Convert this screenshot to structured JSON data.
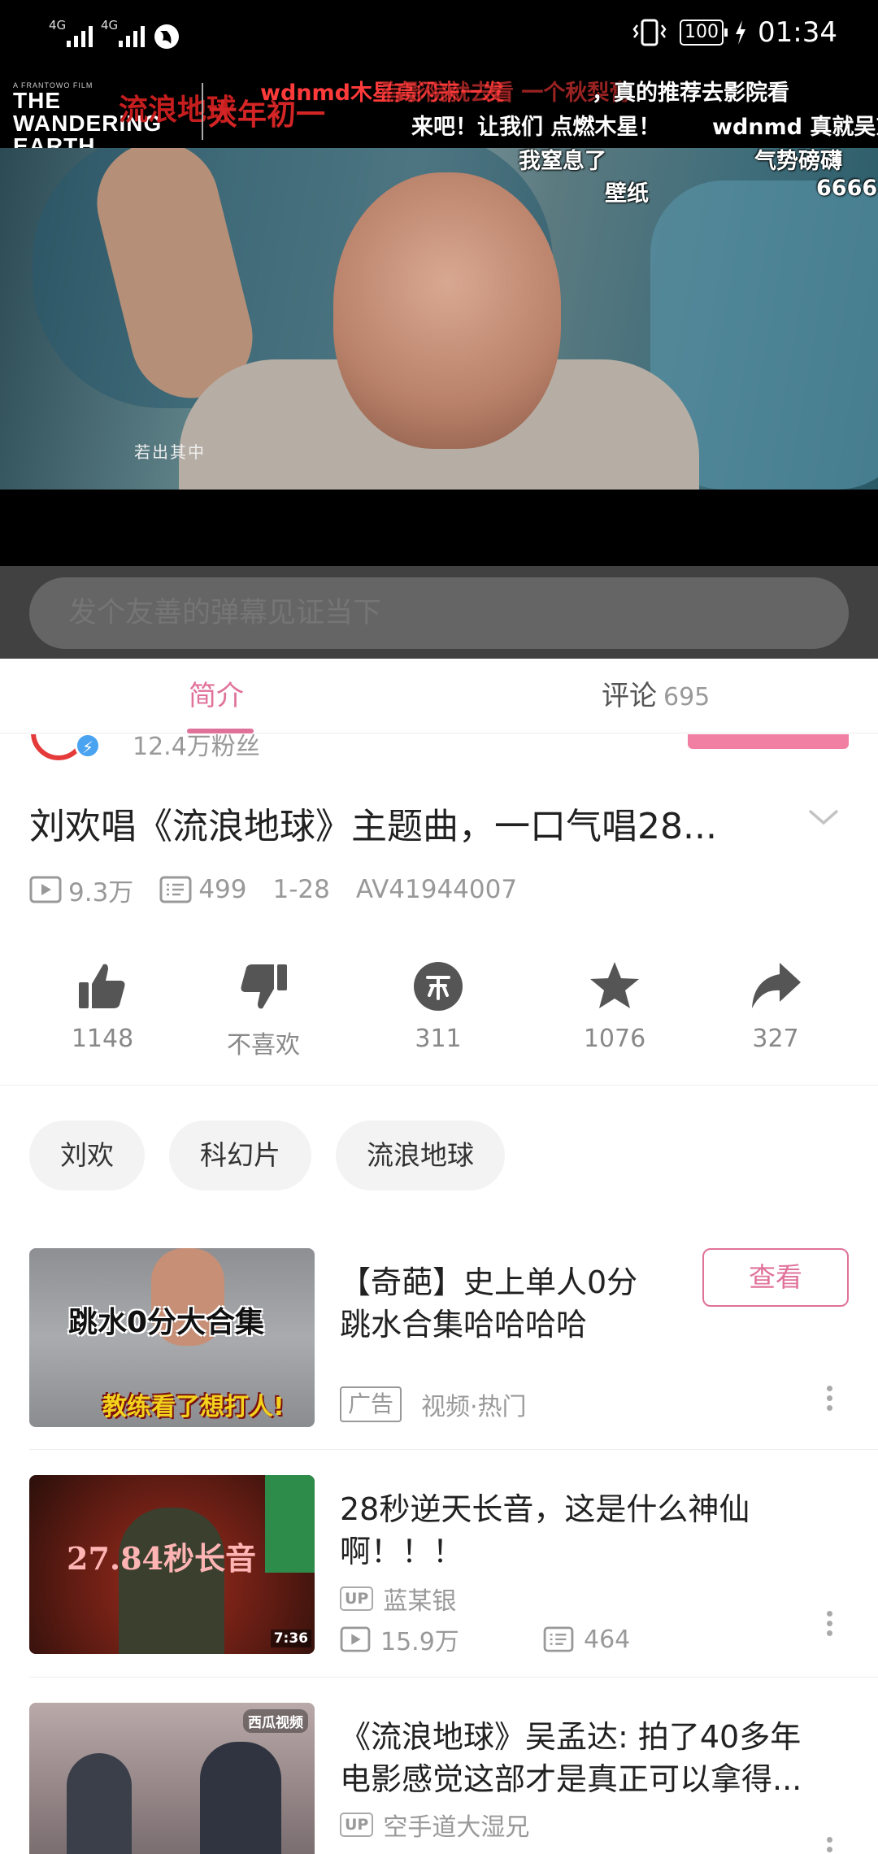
{
  "status_bar": {
    "network1": "4G",
    "network2": "4G",
    "battery": "100",
    "time": "01:34"
  },
  "player": {
    "movie_logo_en": "THE WANDERING EARTH",
    "movie_logo_small": "A FRANTOWO FILM",
    "movie_logo_cn": "流浪地球",
    "movie_logo_slogan": "大年初一",
    "scene_subtitle": "若出其中",
    "danmaku": [
      {
        "text": "wdnmd木星高闪来一发",
        "color": "#ff3a3a"
      },
      {
        "text": "有影院就去看 一个秋梨膏",
        "color": "#ff3a3a"
      },
      {
        "text": "，真的推荐去影院看",
        "color": "#ffffff"
      },
      {
        "text": "来吧！让我们 点燃木星！",
        "color": "#ffffff"
      },
      {
        "text": "wdnmd 真就吴京",
        "color": "#ffffff"
      },
      {
        "text": "我窒息了",
        "color": "#ffffff"
      },
      {
        "text": "气势磅礴",
        "color": "#ffffff"
      },
      {
        "text": "壁纸",
        "color": "#ffffff"
      },
      {
        "text": "6666",
        "color": "#ffffff"
      }
    ]
  },
  "danmaku_input": {
    "placeholder": "发个友善的弹幕见证当下"
  },
  "tabs": [
    {
      "label": "简介",
      "active": true
    },
    {
      "label": "评论",
      "count": "695",
      "active": false
    }
  ],
  "uploader": {
    "fans": "12.4万粉丝"
  },
  "video": {
    "title": "刘欢唱《流浪地球》主题曲，一口气唱28...",
    "plays": "9.3万",
    "danmaku_count": "499",
    "date": "1-28",
    "av": "AV41944007"
  },
  "actions": [
    {
      "name": "like",
      "icon": "thumb-up-icon",
      "label": "1148"
    },
    {
      "name": "dislike",
      "icon": "thumb-down-icon",
      "label": "不喜欢"
    },
    {
      "name": "coin",
      "icon": "coin-icon",
      "label": "311"
    },
    {
      "name": "favorite",
      "icon": "star-icon",
      "label": "1076"
    },
    {
      "name": "share",
      "icon": "share-icon",
      "label": "327"
    }
  ],
  "tags": [
    "刘欢",
    "科幻片",
    "流浪地球"
  ],
  "recommendations": [
    {
      "title_line1": "【奇葩】史上单人0分",
      "title_line2": "跳水合集哈哈哈哈",
      "ad_label": "广告",
      "category": "视频·热门",
      "button": "查看",
      "thumb_text1": "跳水0分大合集",
      "thumb_text2": "教练看了想打人!"
    },
    {
      "title_line1": "28秒逆天长音，这是什么神仙",
      "title_line2": "啊！！！",
      "up_badge": "UP",
      "uploader": "蓝某银",
      "plays": "15.9万",
      "danmaku": "464",
      "thumb_text1": "27.84秒长音",
      "thumb_duration": "7:36"
    },
    {
      "title_line1": "《流浪地球》吴孟达: 拍了40多年",
      "title_line2": "电影感觉这部才是真正可以拿得...",
      "up_badge": "UP",
      "uploader": "空手道大湿兄",
      "thumb_badge": "西瓜视频"
    }
  ],
  "colors": {
    "accent": "#e0729a",
    "follow": "#f07fa3",
    "danmaku_red": "#ff3a3a"
  }
}
